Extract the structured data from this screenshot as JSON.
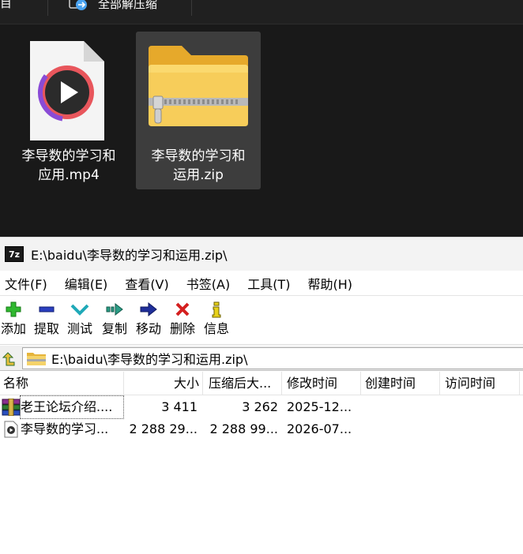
{
  "explorer": {
    "toolbar": {
      "fragment_left": "目",
      "extract_all_label": "全部解压缩"
    },
    "files": [
      {
        "label": "李导数的学习和\n应用.mp4",
        "icon": "video-file-icon",
        "selected": false
      },
      {
        "label": "李导数的学习和\n运用.zip",
        "icon": "zip-folder-icon",
        "selected": true
      }
    ]
  },
  "zip": {
    "title": "E:\\baidu\\李导数的学习和运用.zip\\",
    "app_icon_text": "7z",
    "menu": [
      "文件(F)",
      "编辑(E)",
      "查看(V)",
      "书签(A)",
      "工具(T)",
      "帮助(H)"
    ],
    "tools": [
      {
        "label": "添加",
        "icon": "add-icon"
      },
      {
        "label": "提取",
        "icon": "extract-icon"
      },
      {
        "label": "测试",
        "icon": "test-icon"
      },
      {
        "label": "复制",
        "icon": "copy-icon"
      },
      {
        "label": "移动",
        "icon": "move-icon"
      },
      {
        "label": "删除",
        "icon": "delete-icon"
      },
      {
        "label": "信息",
        "icon": "info-icon"
      }
    ],
    "address": "E:\\baidu\\李导数的学习和运用.zip\\",
    "columns": [
      "名称",
      "大小",
      "压缩后大...",
      "修改时间",
      "创建时间",
      "访问时间"
    ],
    "rows": [
      {
        "name": "老王论坛介绍....",
        "size": "3 411",
        "packed": "3 262",
        "modified": "2025-12...",
        "icon": "rar-archive-icon"
      },
      {
        "name": "李导数的学习...",
        "size": "2 288 29...",
        "packed": "2 288 99...",
        "modified": "2026-07...",
        "icon": "video-file-icon"
      }
    ]
  }
}
